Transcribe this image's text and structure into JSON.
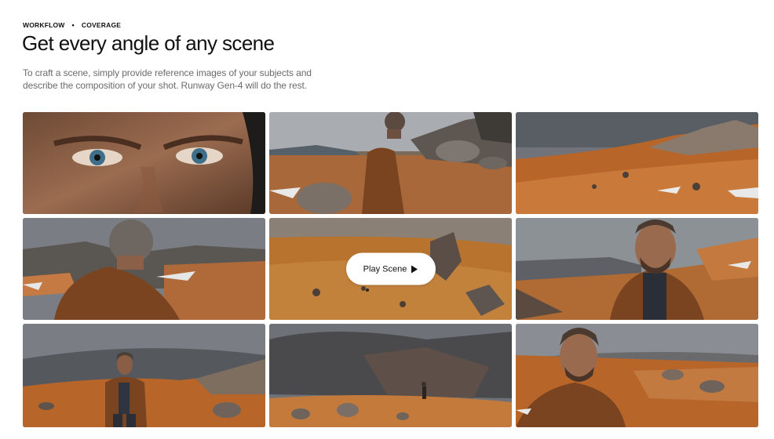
{
  "header": {
    "eyebrow_left": "WORKFLOW",
    "eyebrow_sep": "•",
    "eyebrow_right": "COVERAGE",
    "title": "Get every angle of any scene",
    "description": "To craft a scene, simply provide reference images of your subjects and describe the composition of your shot. Runway Gen-4 will do the rest."
  },
  "gallery": {
    "play_label": "Play Scene",
    "tiles": [
      {
        "name": "closeup-face-eyes"
      },
      {
        "name": "man-back-walking-rocks"
      },
      {
        "name": "rocky-hillside-landscape"
      },
      {
        "name": "man-back-mountains"
      },
      {
        "name": "aerial-rocky-terrain"
      },
      {
        "name": "man-portrait-mountains"
      },
      {
        "name": "man-full-body-landscape"
      },
      {
        "name": "distant-figure-cliff"
      },
      {
        "name": "man-profile-hills"
      }
    ]
  },
  "colors": {
    "text_primary": "#111111",
    "text_secondary": "#6b6b6b",
    "terrain_orange": "#b8652a",
    "sky_grey": "#8a8f96",
    "jacket_brown": "#7a4420"
  },
  "icons": {
    "play": "play-icon"
  }
}
